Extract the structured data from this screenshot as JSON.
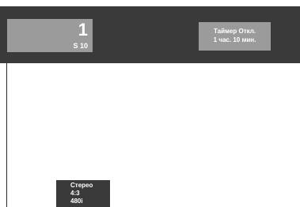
{
  "channel": {
    "number": "1",
    "source": "S 10"
  },
  "sleep_timer": {
    "title": "Таймер Откл.",
    "remaining": "1 час. 10 мин."
  },
  "signal_info": {
    "audio": "Стерео",
    "aspect": "4:3",
    "resolution": "480i"
  },
  "colors": {
    "bar_dark": "#3a3a3a",
    "box_gray": "#9b9b9b",
    "text": "#ffffff"
  }
}
